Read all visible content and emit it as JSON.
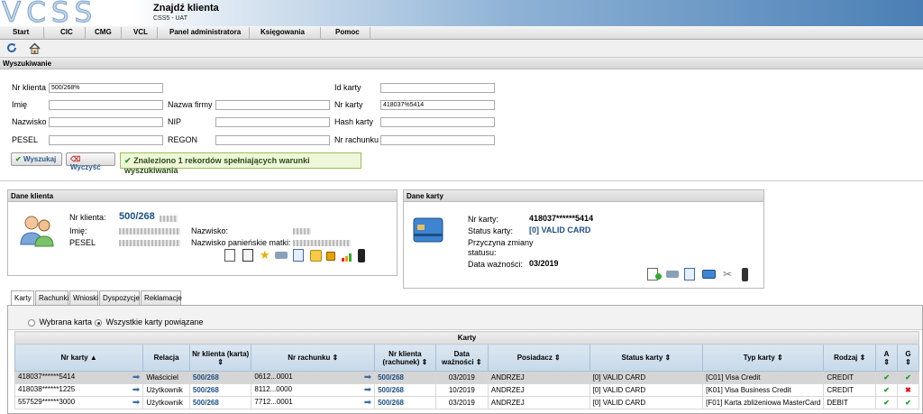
{
  "app": {
    "logo": "VCSS",
    "title": "Znajdź klienta",
    "subtitle": "CSS5 - UAT"
  },
  "menu": [
    "Start",
    "CIC",
    "CMG",
    "VCL",
    "Panel administratora",
    "Księgowania",
    "Pomoc"
  ],
  "search": {
    "section_title": "Wyszukiwanie",
    "labels": {
      "nr_klienta": "Nr klienta",
      "imie": "Imię",
      "nazwisko": "Nazwisko",
      "pesel": "PESEL",
      "nazwa_firmy": "Nazwa firmy",
      "nip": "NIP",
      "regon": "REGON",
      "id_karty": "Id karty",
      "nr_karty": "Nr karty",
      "hash_karty": "Hash karty",
      "nr_rachunku": "Nr rachunku"
    },
    "values": {
      "nr_klienta": "500/268%",
      "nr_karty": "418037%5414"
    },
    "search_button": "Wyszukaj",
    "clear_button": "Wyczyść",
    "result_message": "Znaleziono 1 rekordów spełniających warunki wyszukiwania"
  },
  "client": {
    "title": "Dane klienta",
    "nr_klienta_label": "Nr klienta:",
    "nr_klienta_value": "500/268",
    "imie_label": "Imię:",
    "pesel_label": "PESEL",
    "nazwisko_label": "Nazwisko:",
    "nazwisko_pan_label": "Nazwisko panieńskie matki:"
  },
  "card": {
    "title": "Dane karty",
    "nr_karty_label": "Nr karty:",
    "nr_karty_value": "418037******5414",
    "status_label": "Status karty:",
    "status_value": "[0] VALID CARD",
    "przyczyna_label_1": "Przyczyna zmiany",
    "przyczyna_label_2": "statusu:",
    "data_label": "Data ważności:",
    "data_value": "03/2019"
  },
  "tabs": [
    "Karty",
    "Rachunki",
    "Wnioski",
    "Dyspozycje",
    "Reklamacje"
  ],
  "radios": {
    "option1": "Wybrana karta",
    "option2": "Wszystkie karty powiązane"
  },
  "table": {
    "caption": "Karty",
    "headers": [
      "Nr karty",
      "Relacja",
      "Nr klienta (karta)",
      "Nr rachunku",
      "Nr klienta (rachunek)",
      "Data ważności",
      "Posiadacz",
      "Status karty",
      "Typ karty",
      "Rodzaj",
      "A",
      "G"
    ],
    "rows": [
      {
        "nr_karty": "418037******5414",
        "relacja": "Właściciel",
        "nr_klienta": "500/268",
        "nr_rachunku": "0612...0001",
        "nr_klienta_r": "500/268",
        "data": "03/2019",
        "posiadacz": "ANDRZEJ",
        "status": "[0] VALID CARD",
        "typ": "[C01] Visa Credit",
        "rodzaj": "CREDIT",
        "a": "✔",
        "g": "✔"
      },
      {
        "nr_karty": "418038******1225",
        "relacja": "Użytkownik",
        "nr_klienta": "500/268",
        "nr_rachunku": "8112...0000",
        "nr_klienta_r": "500/268",
        "data": "10/2019",
        "posiadacz": "ANDRZEJ",
        "status": "[0] VALID CARD",
        "typ": "[K01] Visa Business Credit",
        "rodzaj": "CREDIT",
        "a": "✔",
        "g": "✖"
      },
      {
        "nr_karty": "557529******3000",
        "relacja": "Użytkownik",
        "nr_klienta": "500/268",
        "nr_rachunku": "7712...0001",
        "nr_klienta_r": "500/268",
        "data": "03/2019",
        "posiadacz": "ANDRZEJ",
        "status": "[0] VALID CARD",
        "typ": "[F01] Karta zbliżeniowa MasterCard",
        "rodzaj": "DEBIT",
        "a": "✔",
        "g": "✔"
      }
    ]
  }
}
